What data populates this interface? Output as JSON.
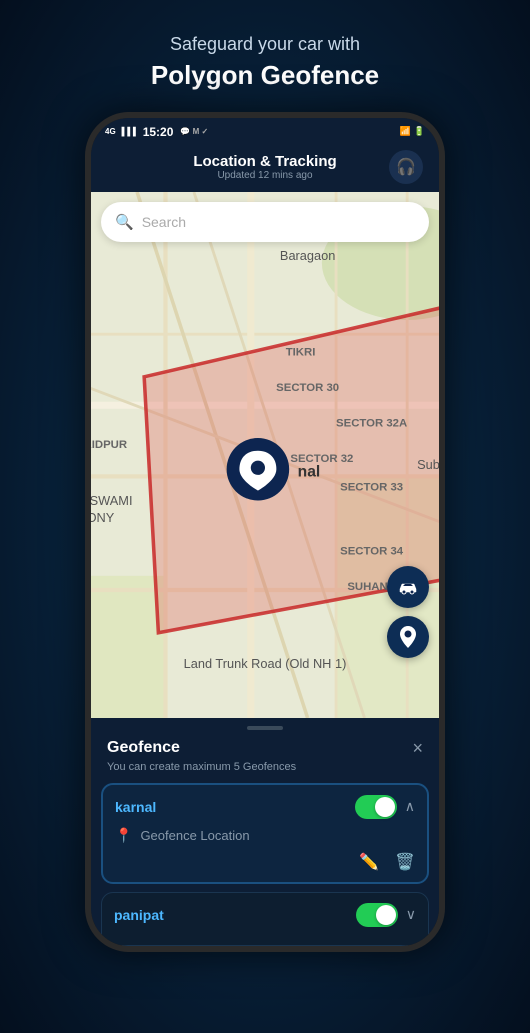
{
  "header": {
    "subtitle": "Safeguard your car with",
    "title": "Polygon Geofence"
  },
  "status_bar": {
    "signal": "4G",
    "time": "15:20",
    "battery": "🔋"
  },
  "app_header": {
    "title": "Location & Tracking",
    "subtitle": "Updated 12 mins ago",
    "headphone_icon": "🎧"
  },
  "search": {
    "placeholder": "Search"
  },
  "map_fabs": [
    {
      "icon": "🚗",
      "name": "car-location-fab"
    },
    {
      "icon": "📍",
      "name": "pin-fab"
    }
  ],
  "bottom_sheet": {
    "title": "Geofence",
    "subtitle": "You can create maximum 5 Geofences",
    "close_label": "×",
    "items": [
      {
        "name": "karnal",
        "enabled": true,
        "expanded": true,
        "location_label": "Geofence Location"
      },
      {
        "name": "panipat",
        "enabled": true,
        "expanded": false
      }
    ]
  }
}
